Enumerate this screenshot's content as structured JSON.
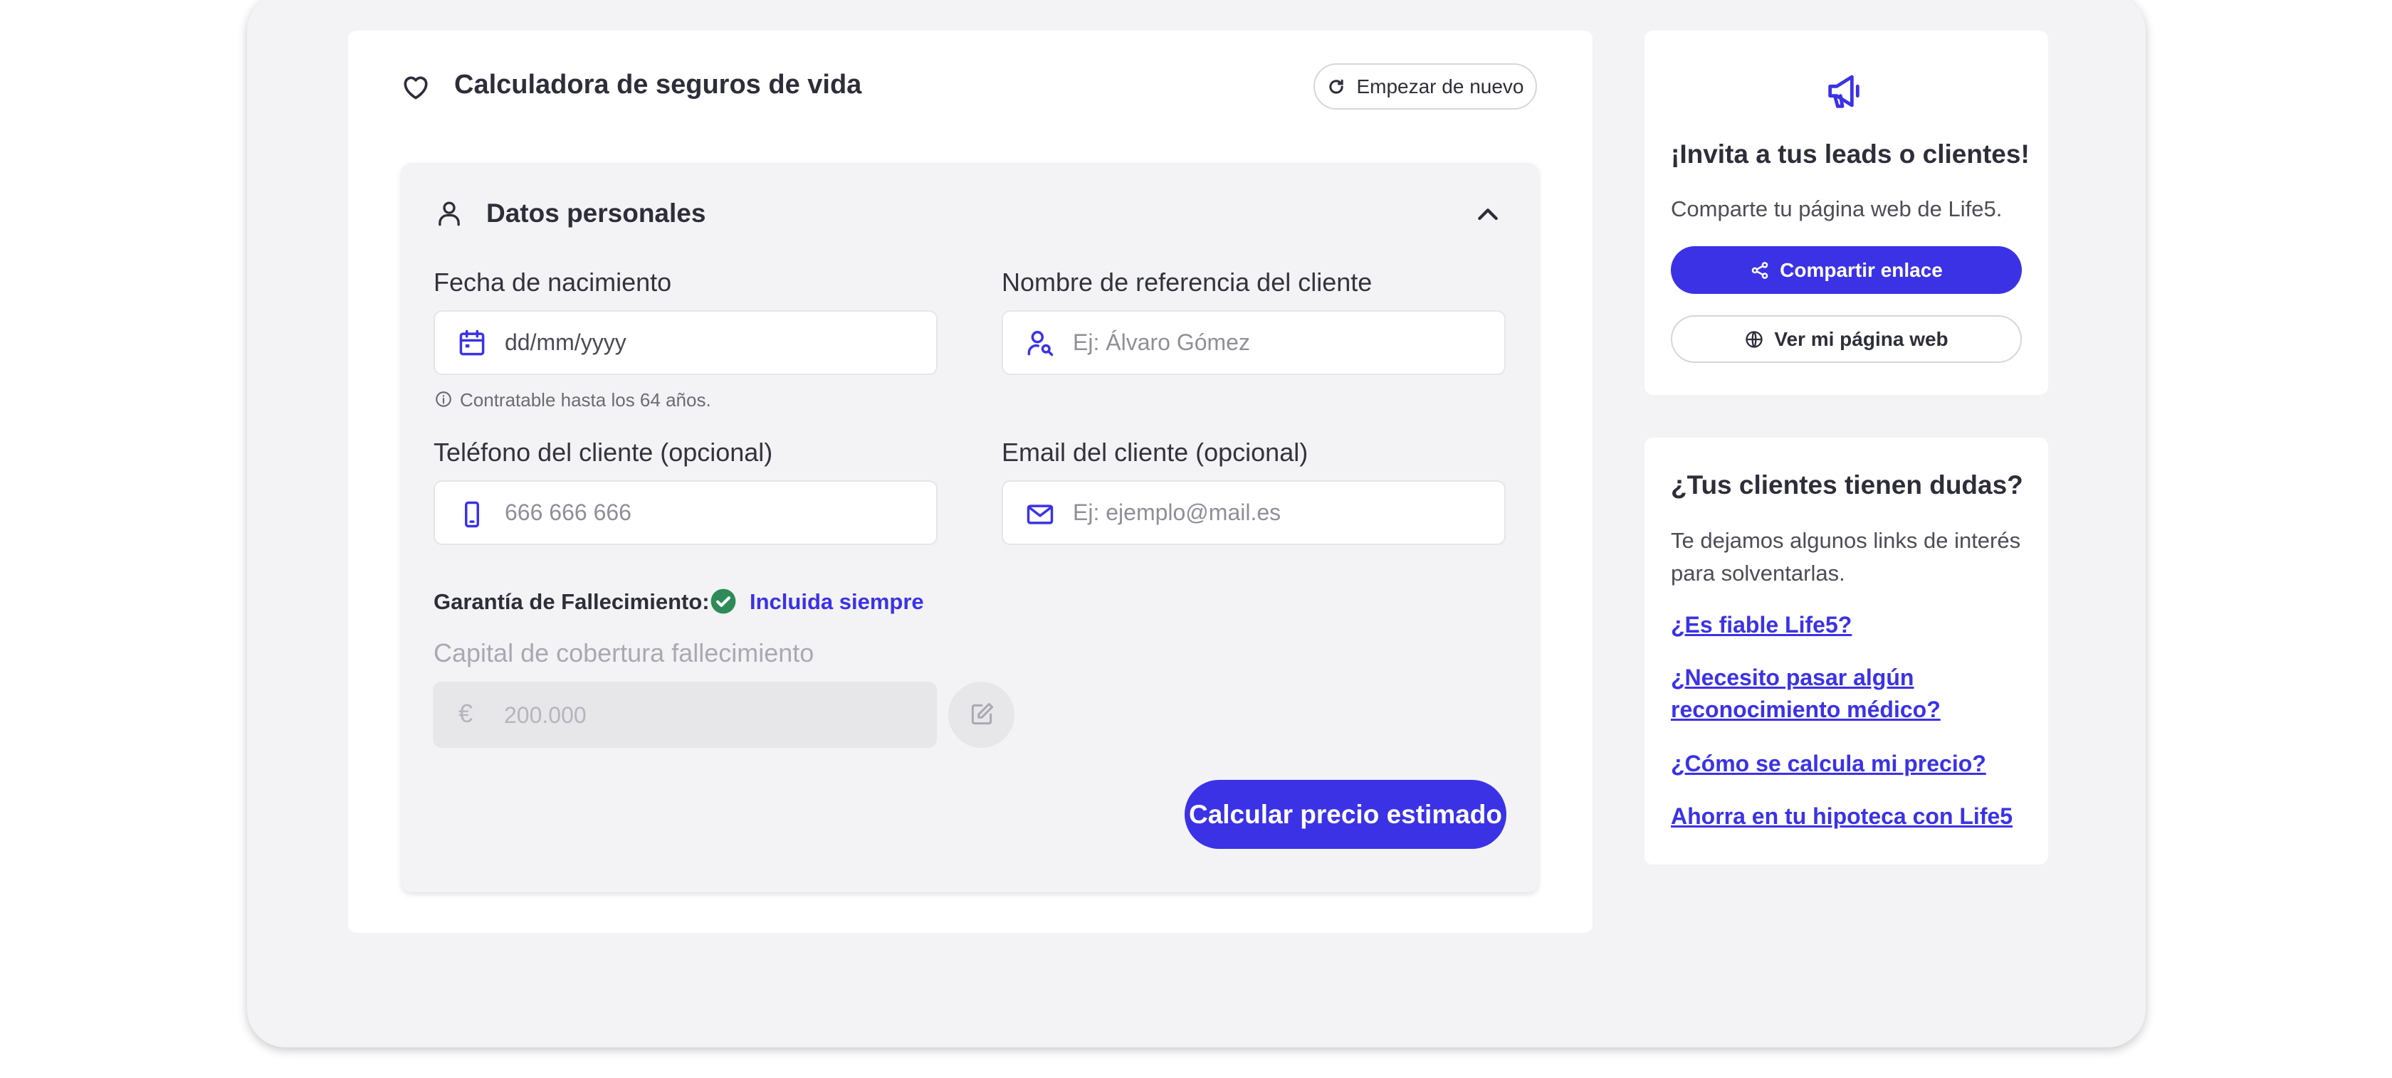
{
  "calculator": {
    "title": "Calculadora de seguros de vida",
    "restart_label": "Empezar de nuevo"
  },
  "personal_section": {
    "title": "Datos personales",
    "birth_label": "Fecha de nacimiento",
    "birth_value": "dd/mm/yyyy",
    "birth_hint": "Contratable hasta los 64 años.",
    "reference_label": "Nombre de referencia del cliente",
    "reference_placeholder": "Ej: Álvaro Gómez",
    "phone_label": "Teléfono del cliente (opcional)",
    "phone_placeholder": "666 666 666",
    "email_label": "Email del cliente (opcional)",
    "email_placeholder": "Ej: ejemplo@mail.es",
    "guarantee_label": "Garantía de Fallecimiento:",
    "guarantee_value": "Incluida siempre",
    "capital_label": "Capital de cobertura fallecimiento",
    "capital_currency": "€",
    "capital_value": "200.000",
    "calculate_label": "Calcular precio estimado"
  },
  "invite_card": {
    "title": "¡Invita a tus leads o clientes!",
    "text": "Comparte tu página web de Life5.",
    "share_label": "Compartir enlace",
    "web_label": "Ver mi página web"
  },
  "faq_card": {
    "title": "¿Tus clientes tienen dudas?",
    "text_line1": "Te dejamos algunos links de interés",
    "text_line2": "para solventarlas.",
    "links": [
      {
        "line1": "¿Es fiable Life5?",
        "line2": ""
      },
      {
        "line1": "¿Necesito pasar algún",
        "line2": "reconocimiento médico?"
      },
      {
        "line1": "¿Cómo se calcula mi precio?",
        "line2": ""
      },
      {
        "line1": "Ahorra en tu hipoteca con Life5",
        "line2": ""
      }
    ]
  },
  "colors": {
    "accent": "#3b32e6",
    "success": "#2e8b57",
    "panel": "#f3f3f5"
  },
  "icons": [
    "heart-icon",
    "refresh-icon",
    "user-icon",
    "chevron-up-icon",
    "calendar-icon",
    "user-search-icon",
    "info-icon",
    "phone-icon",
    "mail-icon",
    "check-circle-icon",
    "euro-icon",
    "pencil-icon",
    "megaphone-icon",
    "share-icon",
    "globe-icon"
  ]
}
